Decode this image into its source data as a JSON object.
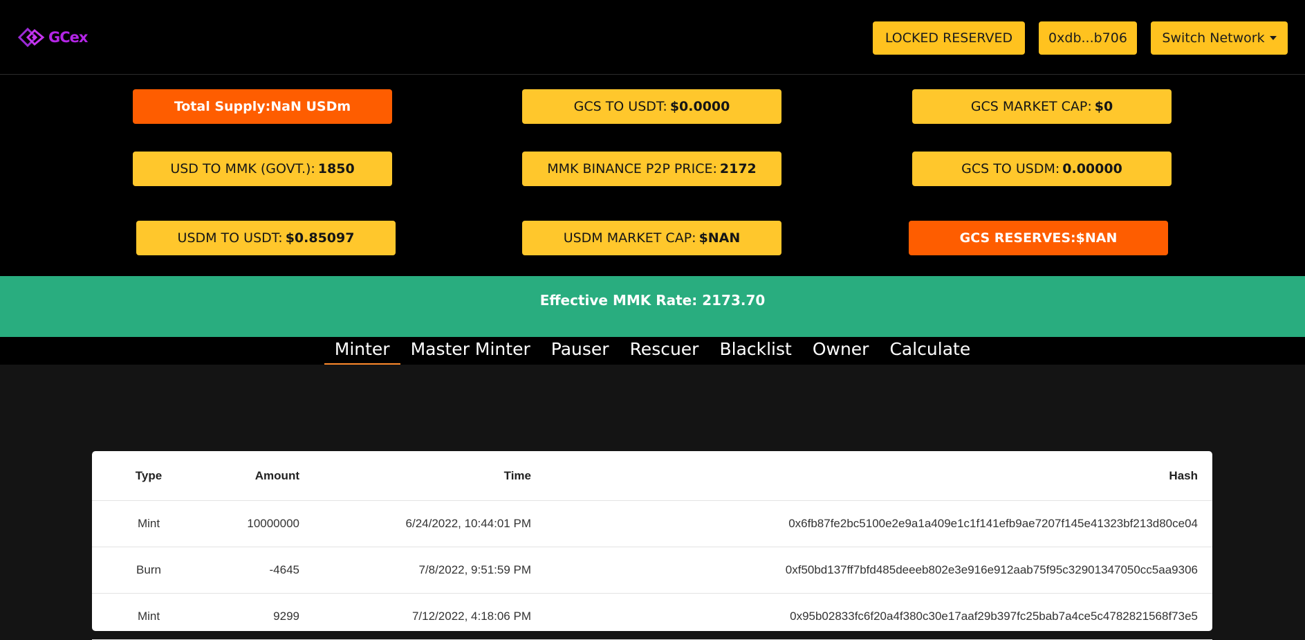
{
  "header": {
    "logo_text": "GCex",
    "locked_reserved_label": "LOCKED RESERVED",
    "wallet_address": "0xdb...b706",
    "switch_network_label": "Switch Network"
  },
  "stats": {
    "total_supply": {
      "label": "Total Supply: ",
      "value": "NaN USDm"
    },
    "gcs_to_usdt": {
      "label": "GCS TO USDT: ",
      "value": "$0.0000"
    },
    "gcs_market_cap": {
      "label": "GCS MARKET CAP: ",
      "value": "$0"
    },
    "usd_to_mmk": {
      "label": "USD TO MMK (GOVT.): ",
      "value": "1850"
    },
    "mmk_binance_p2p": {
      "label": "MMK BINANCE P2P PRICE: ",
      "value": "2172"
    },
    "gcs_to_usdm": {
      "label": "GCS TO USDM: ",
      "value": "0.00000"
    },
    "usdm_to_usdt": {
      "label": "USDM TO USDT: ",
      "value": "$0.85097"
    },
    "usdm_market_cap": {
      "label": "USDM MARKET CAP: ",
      "value": "$NAN"
    },
    "gcs_reserves": {
      "label": "GCS RESERVES: ",
      "value": "$NAN"
    }
  },
  "effective_rate": "Effective MMK Rate: 2173.70",
  "tabs": [
    {
      "label": "Minter",
      "active": true
    },
    {
      "label": "Master Minter"
    },
    {
      "label": "Pauser"
    },
    {
      "label": "Rescuer"
    },
    {
      "label": "Blacklist"
    },
    {
      "label": "Owner"
    },
    {
      "label": "Calculate"
    }
  ],
  "table": {
    "headers": {
      "type": "Type",
      "amount": "Amount",
      "time": "Time",
      "hash": "Hash"
    },
    "rows": [
      {
        "type": "Mint",
        "amount": "10000000",
        "time": "6/24/2022, 10:44:01 PM",
        "hash": "0x6fb87fe2bc5100e2e9a1a409e1c1f141efb9ae7207f145e41323bf213d80ce04"
      },
      {
        "type": "Burn",
        "amount": "-4645",
        "time": "7/8/2022, 9:51:59 PM",
        "hash": "0xf50bd137ff7bfd485deeeb802e3e916e912aab75f95c32901347050cc5aa9306"
      },
      {
        "type": "Mint",
        "amount": "9299",
        "time": "7/12/2022, 4:18:06 PM",
        "hash": "0x95b02833fc6f20a4f380c30e17aaf29b397fc25bab7a4ce5c4782821568f73e5"
      }
    ]
  },
  "colors": {
    "yellow": "#ffc72c",
    "orange": "#fe5d00",
    "green": "#29ad7f",
    "brand": "#b425e6"
  }
}
